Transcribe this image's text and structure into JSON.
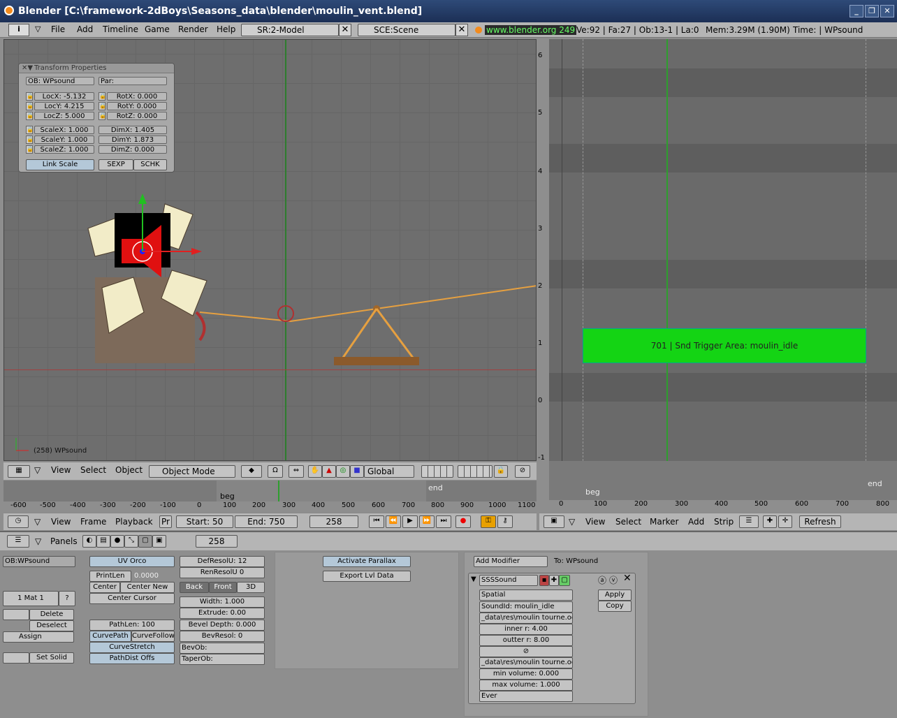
{
  "window": {
    "title": "Blender [C:\\framework-2dBoys\\Seasons_data\\blender\\moulin_vent.blend]"
  },
  "menu": {
    "items": [
      "File",
      "Add",
      "Timeline",
      "Game",
      "Render",
      "Help"
    ],
    "screen": "SR:2-Model",
    "scene": "SCE:Scene",
    "site": "www.blender.org 249",
    "stats": "Ve:92 | Fa:27 | Ob:13-1 | La:0",
    "mem": "Mem:3.29M (1.90M)",
    "time": "Time: | WPsound"
  },
  "transform": {
    "title": "Transform Properties",
    "ob": "OB: WPsound",
    "par": "Par:",
    "locx": "LocX: -5.132",
    "locy": "LocY: 4.215",
    "locz": "LocZ: 5.000",
    "rotx": "RotX: 0.000",
    "roty": "RotY: 0.000",
    "rotz": "RotZ: 0.000",
    "scalex": "ScaleX: 1.000",
    "scaley": "ScaleY: 1.000",
    "scalez": "ScaleZ: 1.000",
    "dimx": "DimX: 1.405",
    "dimy": "DimY: 1.873",
    "dimz": "DimZ: 0.000",
    "linkscale": "Link Scale",
    "sexp": "SEXP",
    "schk": "SCHK"
  },
  "viewport": {
    "object_label": "(258) WPsound",
    "header": {
      "view": "View",
      "select": "Select",
      "object": "Object",
      "mode": "Object Mode",
      "orientation": "Global"
    }
  },
  "seq": {
    "yticks": [
      "6",
      "5",
      "4",
      "3",
      "2",
      "1",
      "0",
      "-1"
    ],
    "strip_label": "701 | Snd Trigger Area: moulin_idle",
    "xticks": [
      "0",
      "100",
      "200",
      "300",
      "400",
      "500",
      "600",
      "700",
      "800"
    ],
    "beg": "beg",
    "end": "end",
    "header": {
      "view": "View",
      "select": "Select",
      "marker": "Marker",
      "add": "Add",
      "strip": "Strip",
      "refresh": "Refresh"
    }
  },
  "timeline": {
    "ticks": [
      "-600",
      "-500",
      "-400",
      "-300",
      "-200",
      "-100",
      "0",
      "100",
      "200",
      "300",
      "400",
      "500",
      "600",
      "700",
      "800",
      "900",
      "1000",
      "1100"
    ],
    "beg": "beg",
    "end": "end",
    "view": "View",
    "frame": "Frame",
    "playback": "Playback",
    "pr": "Pr",
    "start": "Start: 50",
    "endv": "End: 750",
    "current": "258"
  },
  "buttons": {
    "panels": "Panels",
    "frame": "258",
    "ob": "OB:WPsound",
    "mat": "1 Mat 1",
    "q": "?",
    "delete": "Delete",
    "deselect": "Deselect",
    "assign": "Assign",
    "setsolid": "Set Solid",
    "uvorco": "UV Orco",
    "printlen": "PrintLen",
    "printval": "0.0000",
    "center": "Center",
    "centernew": "Center New",
    "centercursor": "Center Cursor",
    "pathlen": "PathLen: 100",
    "curvepath": "CurvePath",
    "curvefollow": "CurveFollow",
    "curvestretch": "CurveStretch",
    "pathdist": "PathDist Offs",
    "defresol": "DefResolU: 12",
    "renresol": "RenResolU 0",
    "back": "Back",
    "front": "Front",
    "threeD": "3D",
    "width": "Width: 1.000",
    "extrude": "Extrude: 0.00",
    "bevel": "Bevel Depth: 0.000",
    "bevresol": "BevResol: 0",
    "bevob": "BevOb:",
    "taperob": "TaperOb:",
    "parallax": "Activate Parallax",
    "export": "Export Lvl Data",
    "addmod": "Add Modifier",
    "to": "To: WPsound",
    "modname": "SSSSound",
    "apply": "Apply",
    "copy": "Copy",
    "spatial": "Spatial",
    "soundid": "SoundId: moulin_idle",
    "path1": "_data\\res\\moulin tourne.ogg",
    "inner": "inner r: 4.00",
    "outter": "outter r: 8.00",
    "path2": "_data\\res\\moulin tourne.ogg",
    "minvol": "min volume: 0.000",
    "maxvol": "max volume: 1.000",
    "ever": "Ever"
  },
  "colors": {
    "strip": "#14d414",
    "title": "#1c2f55",
    "panel": "#b5b5b5"
  }
}
